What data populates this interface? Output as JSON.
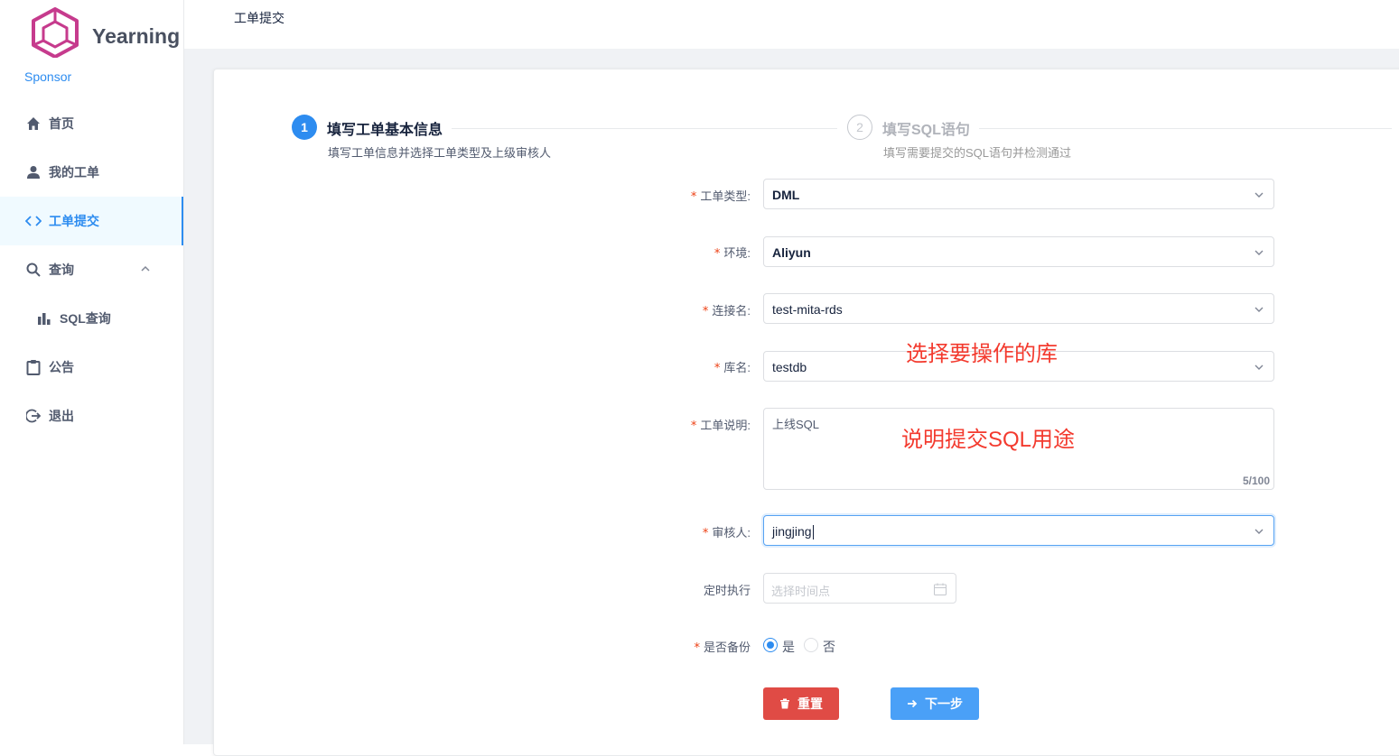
{
  "brand": {
    "name": "Yearning",
    "sponsor": "Sponsor"
  },
  "nav": {
    "items": [
      {
        "label": "首页",
        "icon": "home-icon"
      },
      {
        "label": "我的工单",
        "icon": "user-icon"
      },
      {
        "label": "工单提交",
        "icon": "code-icon",
        "active": true
      },
      {
        "label": "查询",
        "icon": "search-icon",
        "expanded": true
      },
      {
        "label": "SQL查询",
        "icon": "bar-chart-icon",
        "sub": true
      },
      {
        "label": "公告",
        "icon": "clipboard-icon"
      },
      {
        "label": "退出",
        "icon": "logout-icon"
      }
    ]
  },
  "header": {
    "title": "工单提交"
  },
  "steps": [
    {
      "num": "1",
      "title": "填写工单基本信息",
      "desc": "填写工单信息并选择工单类型及上级审核人"
    },
    {
      "num": "2",
      "title": "填写SQL语句",
      "desc": "填写需要提交的SQL语句并检测通过"
    }
  ],
  "form": {
    "type": {
      "label": "工单类型:",
      "value": "DML"
    },
    "env": {
      "label": "环境:",
      "value": "Aliyun"
    },
    "connection": {
      "label": "连接名:",
      "value": "test-mita-rds"
    },
    "database": {
      "label": "库名:",
      "value": "testdb"
    },
    "description": {
      "label": "工单说明:",
      "value": "上线SQL",
      "count": "5/100"
    },
    "auditor": {
      "label": "审核人:",
      "value": "jingjing"
    },
    "schedule": {
      "label": "定时执行",
      "placeholder": "选择时间点"
    },
    "backup": {
      "label": "是否备份",
      "yes": "是",
      "no": "否",
      "selected": "是"
    },
    "buttons": {
      "reset": "重置",
      "next": "下一步"
    }
  },
  "annotations": {
    "database_note": "选择要操作的库",
    "description_note": "说明提交SQL用途"
  },
  "colors": {
    "primary": "#2d8cf0",
    "danger": "#e04b45",
    "required": "#ed4014",
    "annotation": "#f33a2e"
  }
}
